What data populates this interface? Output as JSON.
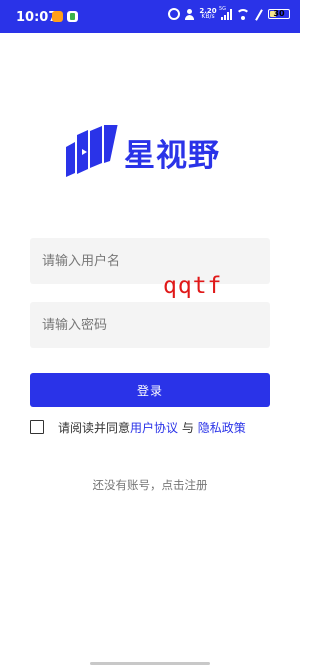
{
  "status_bar": {
    "time": "10:07",
    "net_speed_value": "2.20",
    "net_speed_unit": "KB/s",
    "network_type": "5G",
    "battery_level": "30",
    "background_color": "#2a33e8"
  },
  "logo": {
    "text": "星视野",
    "color": "#2a33e8"
  },
  "form": {
    "username_placeholder": "请输入用户名",
    "password_placeholder": "请输入密码",
    "login_label": "登录"
  },
  "overlay_text": "qqtf",
  "agreement": {
    "prefix": "请阅读并同意",
    "user_agreement": "用户协议",
    "conjunction": "与",
    "privacy_policy": "隐私政策"
  },
  "register_prompt": "还没有账号，点击注册",
  "icons": [
    "alarm-icon",
    "person-icon",
    "signal-icon",
    "wifi-icon",
    "mute-icon",
    "battery-icon",
    "logo-mark-icon",
    "checkbox-icon"
  ]
}
